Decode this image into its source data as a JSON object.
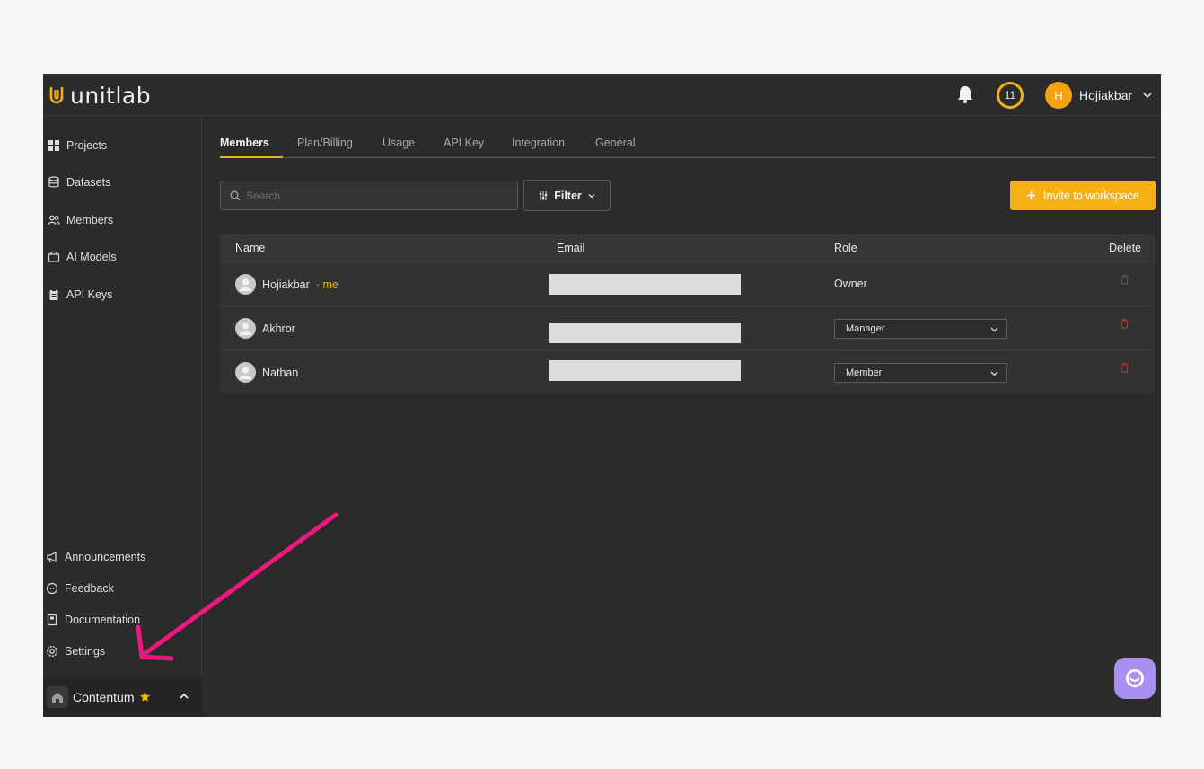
{
  "app": {
    "logo_text": "unitlab",
    "credits": "11",
    "user": {
      "initial": "H",
      "name": "Hojiakbar"
    }
  },
  "sidebar": {
    "top_items": [
      {
        "label": "Projects",
        "icon": "grid-icon"
      },
      {
        "label": "Datasets",
        "icon": "database-icon"
      },
      {
        "label": "Members",
        "icon": "users-icon"
      },
      {
        "label": "AI Models",
        "icon": "box-icon"
      },
      {
        "label": "API Keys",
        "icon": "clipboard-icon"
      }
    ],
    "bottom_items": [
      {
        "label": "Announcements",
        "icon": "megaphone-icon"
      },
      {
        "label": "Feedback",
        "icon": "chat-bubble-icon"
      },
      {
        "label": "Documentation",
        "icon": "book-icon"
      },
      {
        "label": "Settings",
        "icon": "gear-icon"
      }
    ],
    "workspace": {
      "name": "Contentum",
      "icon": "home-icon"
    }
  },
  "tabs": [
    "Members",
    "Plan/Billing",
    "Usage",
    "API Key",
    "Integration",
    "General"
  ],
  "toolbar": {
    "search_placeholder": "Search",
    "filter_label": "Filter",
    "invite_label": "Invite to workspace"
  },
  "table": {
    "headers": {
      "name": "Name",
      "email": "Email",
      "role": "Role",
      "delete": "Delete"
    },
    "rows": [
      {
        "name": "Hojiakbar",
        "me": "me",
        "role": "Owner",
        "editable": false
      },
      {
        "name": "Akhror",
        "role": "Manager",
        "editable": true
      },
      {
        "name": "Nathan",
        "role": "Member",
        "editable": true
      }
    ]
  },
  "colors": {
    "accent": "#f5b014",
    "background": "#2b2b2b",
    "annotation_arrow": "#f0177f",
    "delete_red": "#c0392b",
    "chat_bubble": "#a98ff2"
  },
  "separator": " · "
}
